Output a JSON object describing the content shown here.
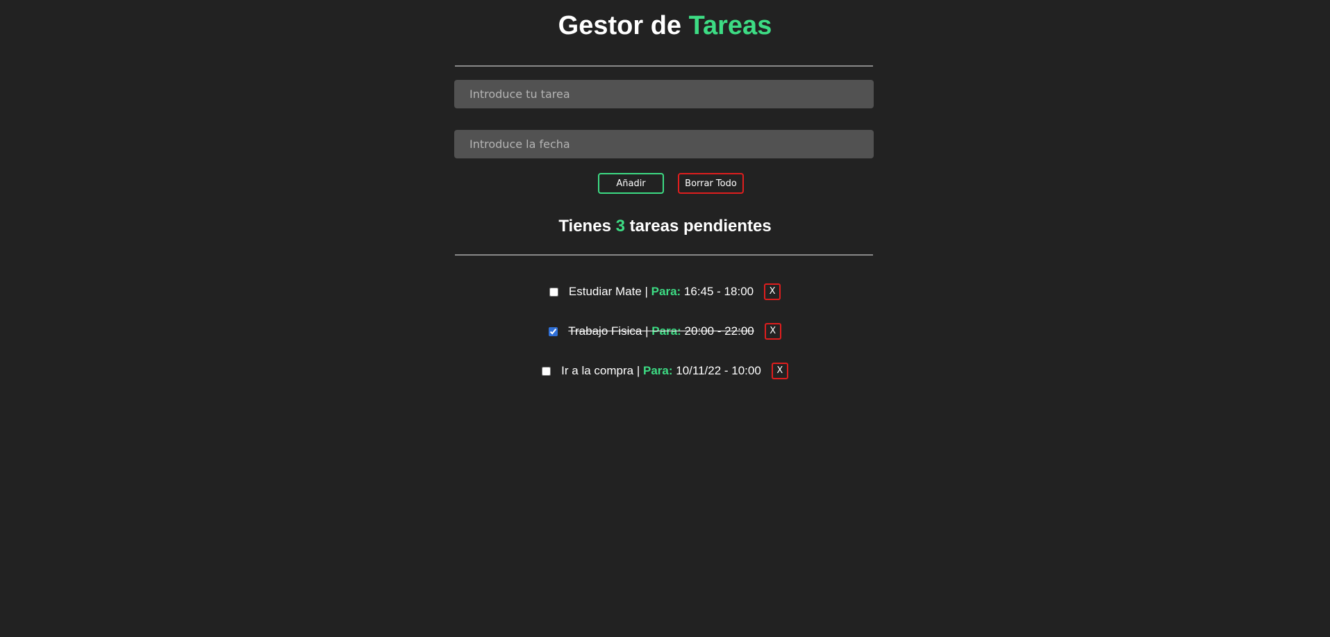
{
  "header": {
    "title_part1": "Gestor de ",
    "title_part2": "Tareas"
  },
  "form": {
    "task_placeholder": "Introduce tu tarea",
    "task_value": "",
    "date_placeholder": "Introduce la fecha",
    "date_value": "",
    "add_label": "Añadir",
    "clear_label": "Borrar Todo"
  },
  "summary": {
    "prefix": "Tienes ",
    "count": "3",
    "suffix": " tareas pendientes"
  },
  "tasks": [
    {
      "name": "Estudiar Mate",
      "separator": " | ",
      "para_label": "Para:",
      "when": " 16:45 - 18:00",
      "checked": false,
      "delete_label": "X"
    },
    {
      "name": "Trabajo Fisica",
      "separator": " | ",
      "para_label": "Para:",
      "when": " 20:00 - 22:00",
      "checked": true,
      "delete_label": "X"
    },
    {
      "name": "Ir a la compra",
      "separator": " | ",
      "para_label": "Para:",
      "when": " 10/11/22 - 10:00",
      "checked": false,
      "delete_label": "X"
    }
  ],
  "colors": {
    "background": "#222222",
    "accent": "#3ddc84",
    "danger": "#e01e1e",
    "input_bg": "#525252"
  }
}
